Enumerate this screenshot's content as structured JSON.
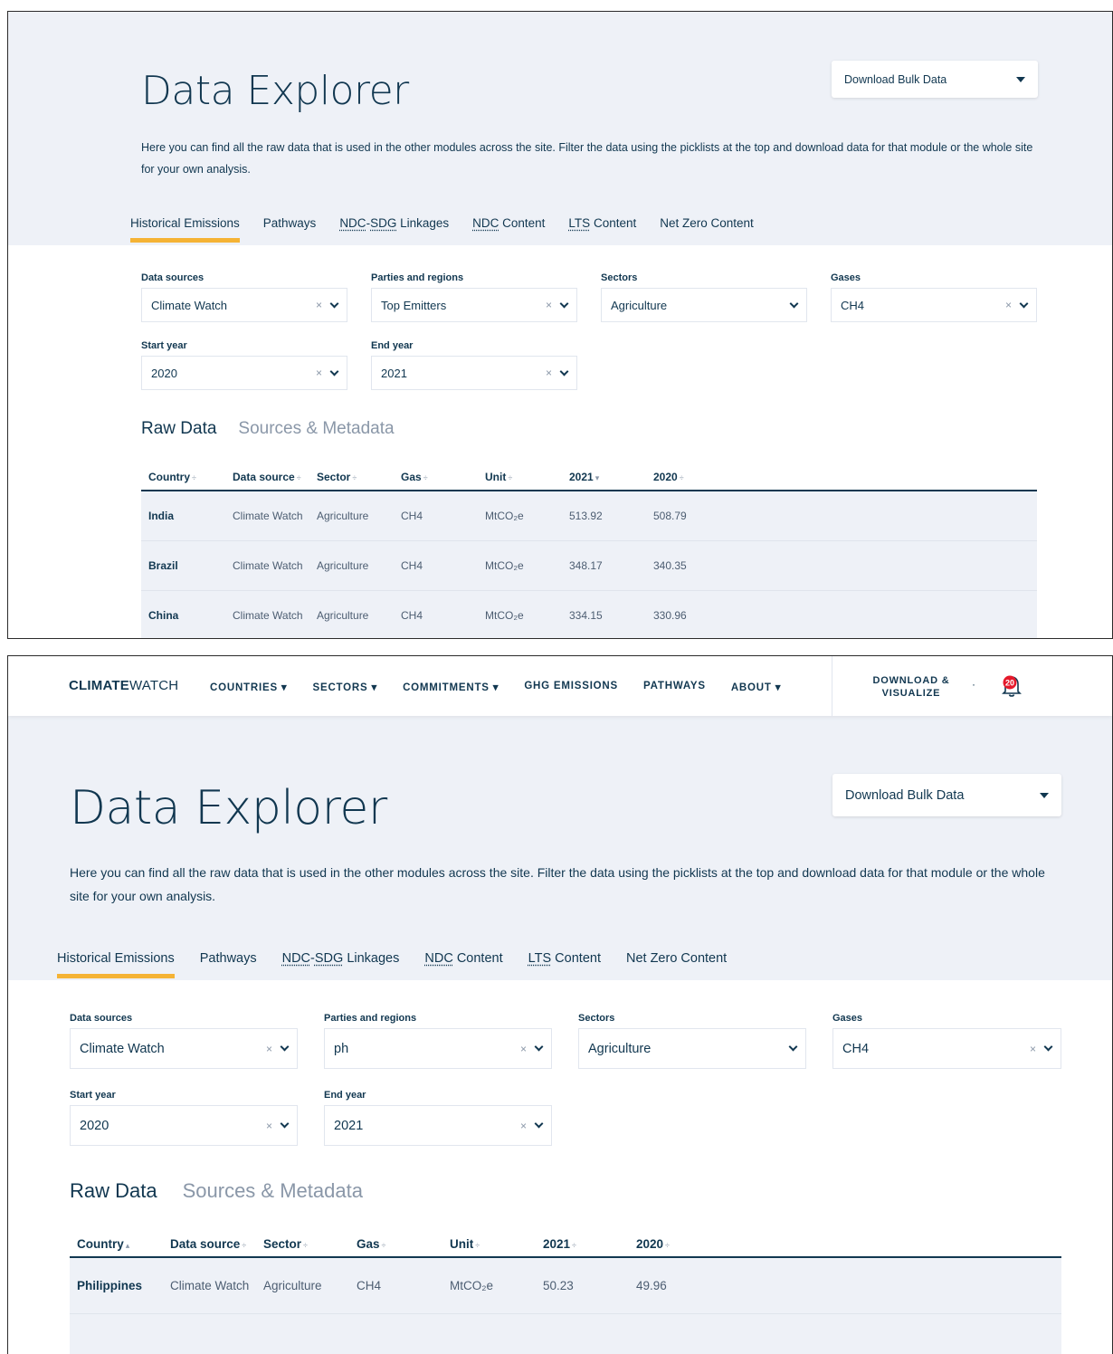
{
  "page": {
    "title": "Data Explorer",
    "description": "Here you can find all the raw data that is used in the other modules across the site. Filter the data using the picklists at the top and download data for that module or the whole site for your own analysis.",
    "bulk_download_label": "Download Bulk Data"
  },
  "navbar": {
    "logo_bold": "CLIMATE",
    "logo_light": "WATCH",
    "items": [
      "COUNTRIES ▾",
      "SECTORS ▾",
      "COMMITMENTS ▾",
      "GHG EMISSIONS",
      "PATHWAYS",
      "ABOUT ▾"
    ],
    "download_visualize": "DOWNLOAD & VISUALIZE",
    "notification_count": "20"
  },
  "tabs": {
    "historical": "Historical Emissions",
    "pathways": "Pathways",
    "ndc_sdg_abbr1": "NDC",
    "ndc_sdg_dash": "-",
    "ndc_sdg_abbr2": "SDG",
    "ndc_sdg_rest": " Linkages",
    "ndc_abbr": "NDC",
    "ndc_rest": " Content",
    "lts_abbr": "LTS",
    "lts_rest": " Content",
    "netzero": "Net Zero Content"
  },
  "filters": {
    "labels": {
      "data_sources": "Data sources",
      "parties": "Parties and regions",
      "sectors": "Sectors",
      "gases": "Gases",
      "start_year": "Start year",
      "end_year": "End year"
    },
    "clear_symbol": "×"
  },
  "raw_tabs": {
    "raw": "Raw Data",
    "sources": "Sources & Metadata"
  },
  "table_headers": [
    "Country",
    "Data source",
    "Sector",
    "Gas",
    "Unit",
    "2021",
    "2020"
  ],
  "panel1": {
    "filters": {
      "data_sources": "Climate Watch",
      "parties": "Top Emitters",
      "sectors": "Agriculture",
      "gases": "CH4",
      "start_year": "2020",
      "end_year": "2021"
    },
    "sort_marks": [
      "÷",
      "÷",
      "÷",
      "÷",
      "÷",
      "▾",
      "÷"
    ],
    "rows": [
      [
        "India",
        "Climate Watch",
        "Agriculture",
        "CH4",
        "MtCO₂e",
        "513.92",
        "508.79"
      ],
      [
        "Brazil",
        "Climate Watch",
        "Agriculture",
        "CH4",
        "MtCO₂e",
        "348.17",
        "340.35"
      ],
      [
        "China",
        "Climate Watch",
        "Agriculture",
        "CH4",
        "MtCO₂e",
        "334.15",
        "330.96"
      ]
    ]
  },
  "panel2": {
    "filters": {
      "data_sources": "Climate Watch",
      "parties": "ph",
      "sectors": "Agriculture",
      "gases": "CH4",
      "start_year": "2020",
      "end_year": "2021"
    },
    "sort_marks": [
      "▴",
      "÷",
      "÷",
      "÷",
      "÷",
      "÷",
      "÷"
    ],
    "rows": [
      [
        "Philippines",
        "Climate Watch",
        "Agriculture",
        "CH4",
        "MtCO₂e",
        "50.23",
        "49.96"
      ]
    ]
  },
  "colors": {
    "navy": "#113750",
    "hero_bg": "#eef1f7",
    "accent_yellow": "#f5b335",
    "bell_red": "#e5192b"
  }
}
